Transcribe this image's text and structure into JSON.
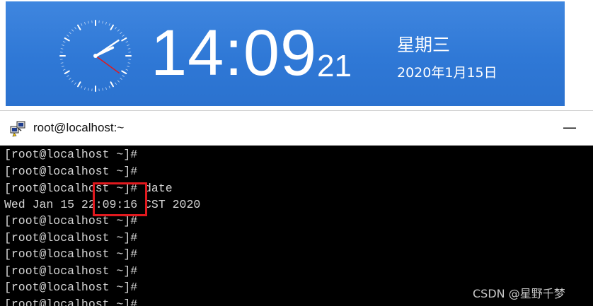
{
  "clock": {
    "time": "14:09",
    "seconds": "21",
    "weekday": "星期三",
    "date": "2020年1月15日",
    "hands": {
      "hour": 14,
      "minute": 9,
      "second": 21
    },
    "background_color": "#2f78d6",
    "second_hand_color": "#e0191e"
  },
  "terminal": {
    "title": "root@localhost:~",
    "minimize_label": "—",
    "lines": [
      "[root@localhost ~]#",
      "[root@localhost ~]#",
      "[root@localhost ~]# date",
      "Wed Jan 15 22:09:16 CST 2020",
      "[root@localhost ~]#",
      "[root@localhost ~]#",
      "[root@localhost ~]#",
      "[root@localhost ~]#",
      "[root@localhost ~]#",
      "[root@localhost ~]#"
    ],
    "text_color": "#d6d6d6",
    "background_color": "#000000",
    "highlight_color": "#e0191e"
  },
  "watermark": "CSDN @星野千梦"
}
